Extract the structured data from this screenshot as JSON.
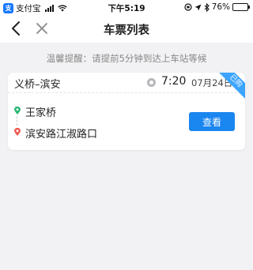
{
  "statusbar": {
    "carrier": "支付宝",
    "time": "下午5:19",
    "battery": "76%",
    "battery_level": 0.76
  },
  "navbar": {
    "title": "车票列表"
  },
  "tip": "温馨提醒：请提前5分钟到达上车站等候",
  "ticket": {
    "route": "义桥–滨安",
    "time": "7:20",
    "date": "07月24日",
    "badge": "已购",
    "stop_from": "王家桥",
    "stop_to": "滨安路江淑路口",
    "view_label": "查看"
  },
  "colors": {
    "accent": "#1a86f0",
    "badge": "#3ba4ff",
    "from_dot": "#2bb673",
    "to_dot": "#f0584f"
  }
}
